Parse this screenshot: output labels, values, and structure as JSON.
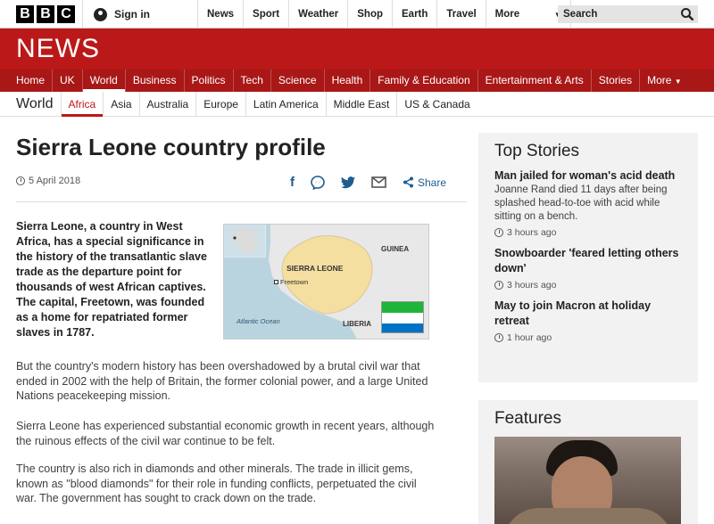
{
  "bbc_logo": [
    "B",
    "B",
    "C"
  ],
  "signin": {
    "label": "Sign in",
    "icon": "person-icon"
  },
  "topnav": [
    "News",
    "Sport",
    "Weather",
    "Shop",
    "Earth",
    "Travel"
  ],
  "topnav_more": "More",
  "search": {
    "label": "Search",
    "icon": "search-icon"
  },
  "news_logo": "NEWS",
  "mainnav": [
    "Home",
    "UK",
    "World",
    "Business",
    "Politics",
    "Tech",
    "Science",
    "Health",
    "Family & Education",
    "Entertainment & Arts",
    "Stories"
  ],
  "mainnav_more": "More",
  "subnav": {
    "section": "World",
    "items": [
      "Africa",
      "Asia",
      "Australia",
      "Europe",
      "Latin America",
      "Middle East",
      "US & Canada"
    ]
  },
  "article": {
    "title": "Sierra Leone country profile",
    "date": "5 April 2018",
    "share_label": "Share",
    "intro": "Sierra Leone, a country in West Africa, has a special significance in the history of the transatlantic slave trade as the departure point for thousands of west African captives. The capital, Freetown, was founded as a home for repatriated former slaves in 1787.",
    "paragraphs": [
      "But the country's modern history has been overshadowed by a brutal civil war that ended in 2002 with the help of Britain, the former colonial power, and a large United Nations peacekeeping mission.",
      "Sierra Leone has experienced substantial economic growth in recent years, although the ruinous effects of the civil war continue to be felt.",
      "The country is also rich in diamonds and other minerals. The trade in illicit gems, known as \"blood diamonds\" for their role in funding conflicts, perpetuated the civil war. The government has sought to crack down on the trade."
    ],
    "map": {
      "country": "SIERRA LEONE",
      "capital": "Freetown",
      "neighbor_north": "GUINEA",
      "neighbor_south": "LIBERIA",
      "ocean": "Atlantic Ocean",
      "flag_colors": [
        "#1eb53a",
        "#ffffff",
        "#0072c6"
      ]
    }
  },
  "top_stories": {
    "heading": "Top Stories",
    "items": [
      {
        "title": "Man jailed for woman's acid death",
        "summary": "Joanne Rand died 11 days after being splashed head-to-toe with acid while sitting on a bench.",
        "time": "3 hours ago"
      },
      {
        "title": "Snowboarder 'feared letting others down'",
        "summary": "",
        "time": "3 hours ago"
      },
      {
        "title": "May to join Macron at holiday retreat",
        "summary": "",
        "time": "1 hour ago"
      }
    ]
  },
  "features": {
    "heading": "Features"
  },
  "colors": {
    "brand_red": "#bb1919",
    "nav_red": "#a91717",
    "link_blue": "#1e5c8e"
  }
}
